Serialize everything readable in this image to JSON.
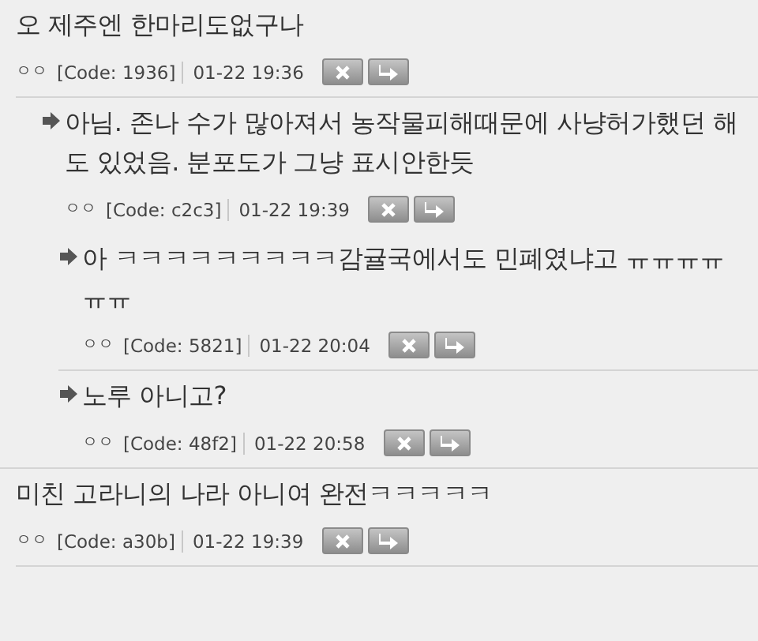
{
  "comments": [
    {
      "text": "오 제주엔 한마리도없구나",
      "author": "ㅇㅇ",
      "code": "[Code: 1936]",
      "time": "01-22 19:36",
      "children": [
        {
          "text": "아님. 존나 수가 많아져서 농작물피해때문에 사냥허가했던 해도 있었음. 분포도가 그냥 표시안한듯",
          "author": "ㅇㅇ",
          "code": "[Code: c2c3]",
          "time": "01-22 19:39",
          "children": [
            {
              "text": "아 ㅋㅋㅋㅋㅋㅋㅋㅋㅋ감귤국에서도 민폐였냐고 ㅠㅠㅠㅠㅠㅠ",
              "author": "ㅇㅇ",
              "code": "[Code: 5821]",
              "time": "01-22 20:04"
            },
            {
              "text": "노루 아니고?",
              "author": "ㅇㅇ",
              "code": "[Code: 48f2]",
              "time": "01-22 20:58"
            }
          ]
        }
      ]
    },
    {
      "text": "미친 고라니의 나라 아니여 완전ㅋㅋㅋㅋㅋ",
      "author": "ㅇㅇ",
      "code": "[Code: a30b]",
      "time": "01-22 19:39"
    }
  ]
}
